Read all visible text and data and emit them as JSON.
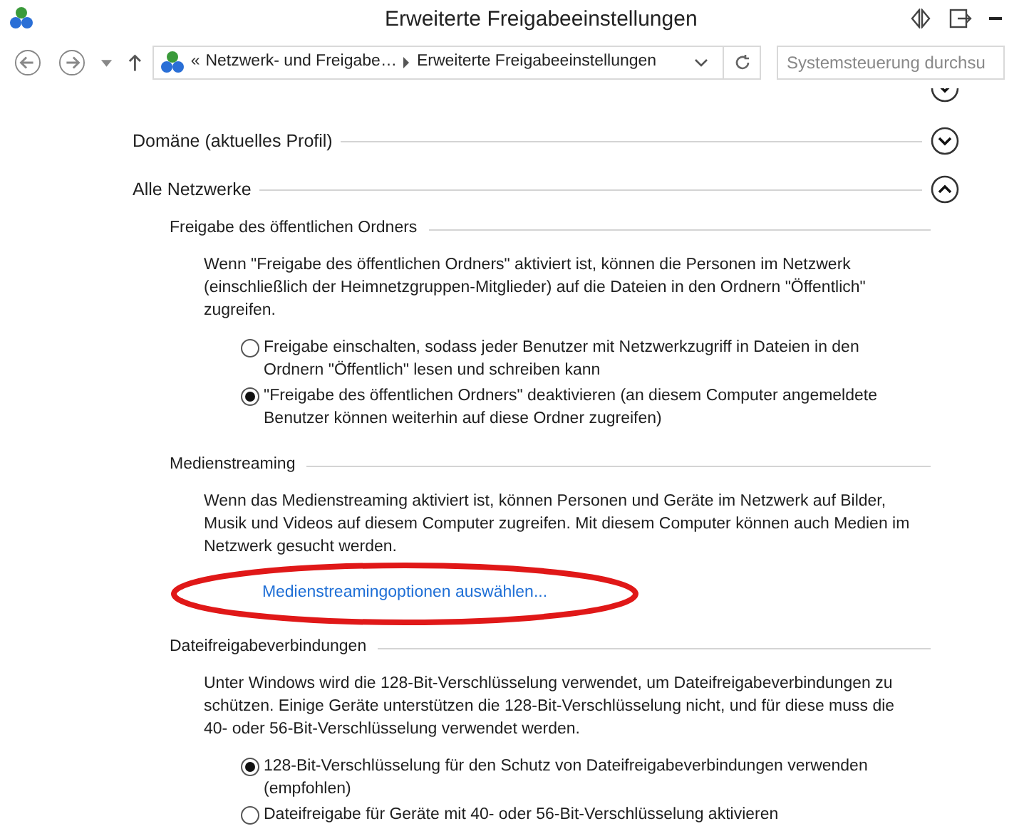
{
  "window": {
    "title": "Erweiterte Freigabeeinstellungen"
  },
  "address_bar": {
    "overflow": "«",
    "breadcrumb": [
      "Netzwerk- und Freigabe…",
      "Erweiterte Freigabeeinstellungen"
    ]
  },
  "search": {
    "placeholder": "Systemsteuerung durchsu"
  },
  "sections": [
    {
      "title": "Domäne (aktuelles Profil)",
      "expanded": false
    },
    {
      "title": "Alle Netzwerke",
      "expanded": true,
      "groups": [
        {
          "title": "Freigabe des öffentlichen Ordners",
          "description": "Wenn \"Freigabe des öffentlichen Ordners\" aktiviert ist, können die Personen im Netzwerk (einschließlich der Heimnetzgruppen-Mitglieder) auf die Dateien in den Ordnern \"Öffentlich\" zugreifen.",
          "options": [
            {
              "label": "Freigabe einschalten, sodass jeder Benutzer mit Netzwerkzugriff in Dateien in den Ordnern \"Öffentlich\" lesen und schreiben kann",
              "selected": false
            },
            {
              "label": "\"Freigabe des öffentlichen Ordners\" deaktivieren (an diesem Computer angemeldete Benutzer können weiterhin auf diese Ordner zugreifen)",
              "selected": true
            }
          ]
        },
        {
          "title": "Medienstreaming",
          "description": "Wenn das Medienstreaming aktiviert ist, können Personen und Geräte im Netzwerk auf Bilder, Musik und Videos auf diesem Computer zugreifen. Mit diesem Computer können auch Medien im Netzwerk gesucht werden.",
          "link": "Medienstreamingoptionen auswählen..."
        },
        {
          "title": "Dateifreigabeverbindungen",
          "description": "Unter Windows wird die 128-Bit-Verschlüsselung verwendet, um Dateifreigabeverbindungen zu schützen. Einige Geräte unterstützen die 128-Bit-Verschlüsselung nicht, und für diese muss die 40- oder 56-Bit-Verschlüsselung verwendet werden.",
          "options": [
            {
              "label": "128-Bit-Verschlüsselung für den Schutz von Dateifreigabeverbindungen verwenden (empfohlen)",
              "selected": true
            },
            {
              "label": "Dateifreigabe für Geräte mit 40- oder 56-Bit-Verschlüsselung aktivieren",
              "selected": false
            }
          ]
        }
      ]
    }
  ]
}
